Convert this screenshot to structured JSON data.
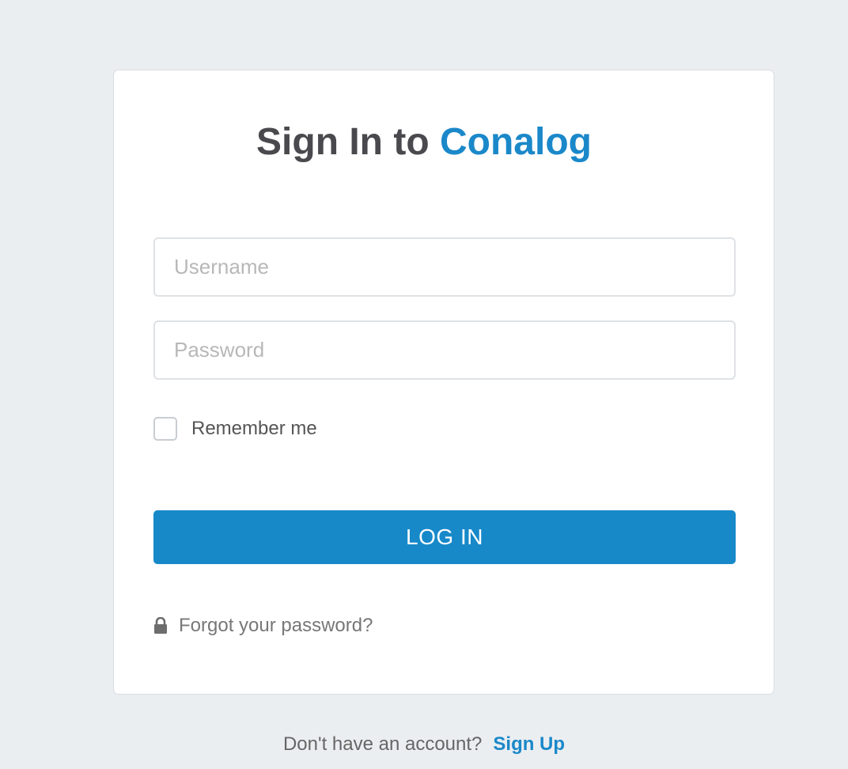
{
  "login": {
    "title_prefix": "Sign In to",
    "title_brand": "Conalog",
    "username_placeholder": "Username",
    "password_placeholder": "Password",
    "remember_label": "Remember me",
    "login_button": "LOG IN",
    "forgot_link": "Forgot your password?"
  },
  "footer": {
    "prompt": "Don't have an account?",
    "signup_link": "Sign Up"
  },
  "colors": {
    "brand": "#1a88c9",
    "background": "#ebeef1",
    "button": "#1789c9"
  },
  "icons": {
    "forgot": "lock-icon"
  }
}
